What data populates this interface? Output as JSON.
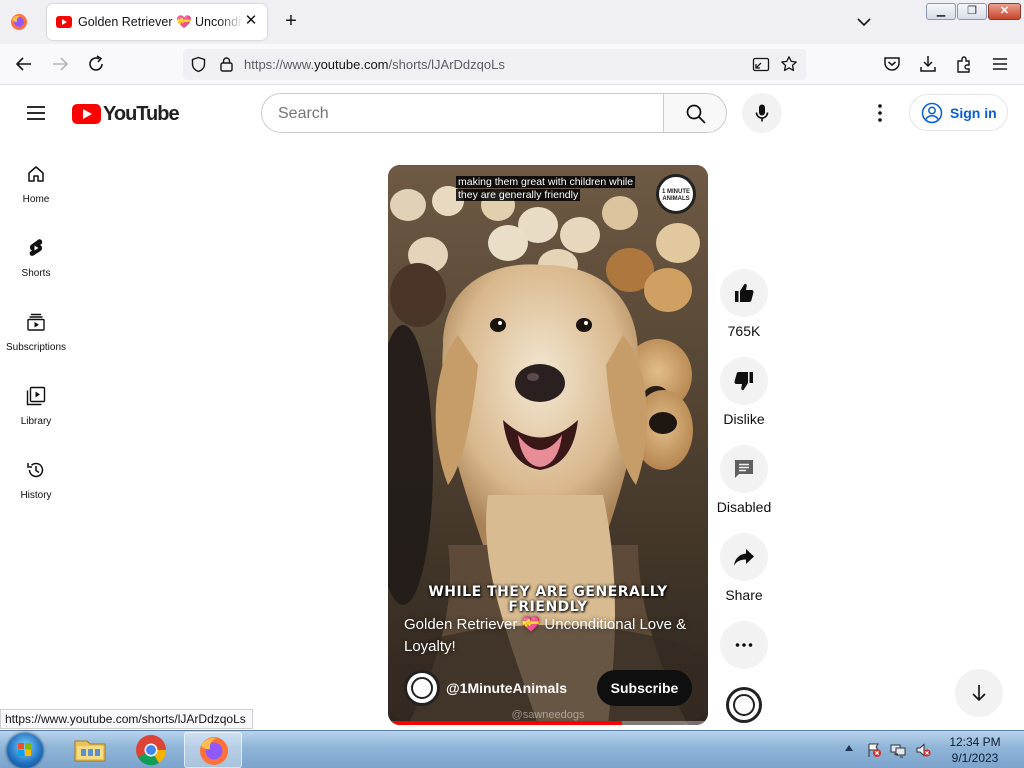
{
  "browser": {
    "tab": {
      "title": "Golden Retriever 💝 Unconditional Love & Loyalty!"
    },
    "url": {
      "prefix": "https://www.",
      "domain": "youtube.com",
      "path": "/shorts/lJArDdzqoLs"
    },
    "status_url": "https://www.youtube.com/shorts/lJArDdzqoLs"
  },
  "masthead": {
    "logo_text": "YouTube",
    "search_placeholder": "Search",
    "signin_label": "Sign in"
  },
  "guide": {
    "items": [
      {
        "label": "Home",
        "icon": "home-icon"
      },
      {
        "label": "Shorts",
        "icon": "shorts-icon"
      },
      {
        "label": "Subscriptions",
        "icon": "subscriptions-icon"
      },
      {
        "label": "Library",
        "icon": "library-icon"
      },
      {
        "label": "History",
        "icon": "history-icon"
      }
    ]
  },
  "short": {
    "caption_top": "making them great with children while they are generally friendly",
    "burned_text": "WHILE THEY ARE GENERALLY FRIENDLY",
    "title": "Golden Retriever 💝 Unconditional Love & Loyalty!",
    "channel": "@1MinuteAnimals",
    "subscribe_label": "Subscribe",
    "watermark": "@sawneedogs",
    "badge_text": "1 MINUTE ANIMALS",
    "progress_fraction": 0.73
  },
  "actions": {
    "like_count": "765K",
    "dislike_label": "Dislike",
    "comments_label": "Disabled",
    "share_label": "Share"
  },
  "taskbar": {
    "time": "12:34 PM",
    "date": "9/1/2023"
  },
  "colors": {
    "youtube_red": "#ff0000",
    "link_blue": "#065fd4",
    "chip_gray": "#f2f2f2"
  }
}
